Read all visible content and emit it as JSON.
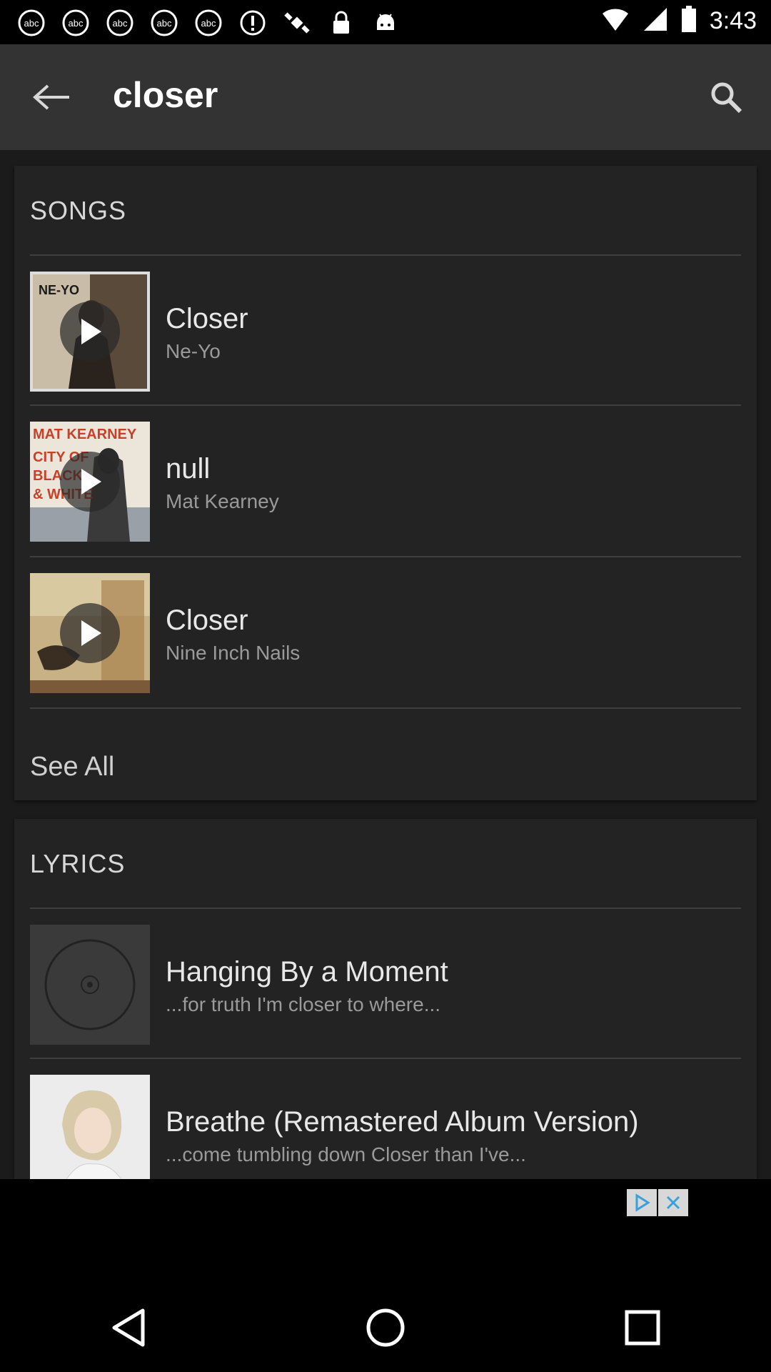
{
  "status_bar": {
    "time": "3:43",
    "icons": [
      "abc-news-icon",
      "abc-news-icon",
      "abc-news-icon",
      "abc-news-icon",
      "abc-news-icon",
      "info-icon",
      "satellite-icon",
      "lock-icon",
      "android-icon"
    ]
  },
  "app_bar": {
    "title": "closer"
  },
  "songs": {
    "heading": "SONGS",
    "items": [
      {
        "title": "Closer",
        "artist": "Ne-Yo",
        "art_text": "NE-YO"
      },
      {
        "title": "null",
        "artist": "Mat Kearney",
        "art_text": "MAT KEARNEY\nCITY OF\nBLACK\n& WHITE"
      },
      {
        "title": "Closer",
        "artist": "Nine Inch Nails",
        "art_text": ""
      }
    ],
    "see_all": "See All"
  },
  "lyrics": {
    "heading": "LYRICS",
    "items": [
      {
        "title": "Hanging By a Moment",
        "snippet": "...for truth I'm closer to where..."
      },
      {
        "title": "Breathe (Remastered Album Version)",
        "snippet": "...come tumbling down Closer than I've..."
      }
    ]
  },
  "colors": {
    "app_bar": "#333333",
    "content_bg": "#1b1b1b",
    "card_bg": "#232323",
    "text_primary": "#e8e8e8",
    "text_secondary": "#9a9a9a"
  }
}
